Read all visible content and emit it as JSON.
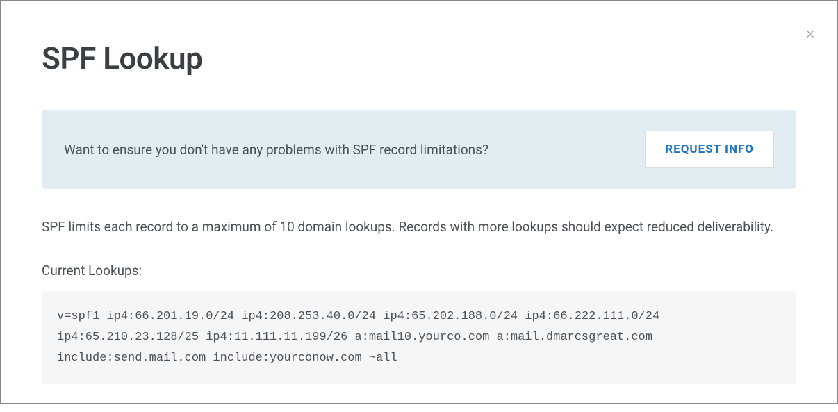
{
  "modal": {
    "title": "SPF Lookup",
    "close_label": "×"
  },
  "banner": {
    "message": "Want to ensure you don't have any problems with SPF record limitations?",
    "button_label": "REQUEST INFO"
  },
  "content": {
    "description": "SPF limits each record to a maximum of 10 domain lookups. Records with more lookups should expect reduced deliverability.",
    "lookups_label": "Current Lookups:",
    "spf_record": "v=spf1 ip4:66.201.19.0/24 ip4:208.253.40.0/24 ip4:65.202.188.0/24 ip4:66.222.111.0/24 ip4:65.210.23.128/25 ip4:11.111.11.199/26 a:mail10.yourco.com a:mail.dmarcsgreat.com include:send.mail.com include:yourconow.com ~all"
  }
}
